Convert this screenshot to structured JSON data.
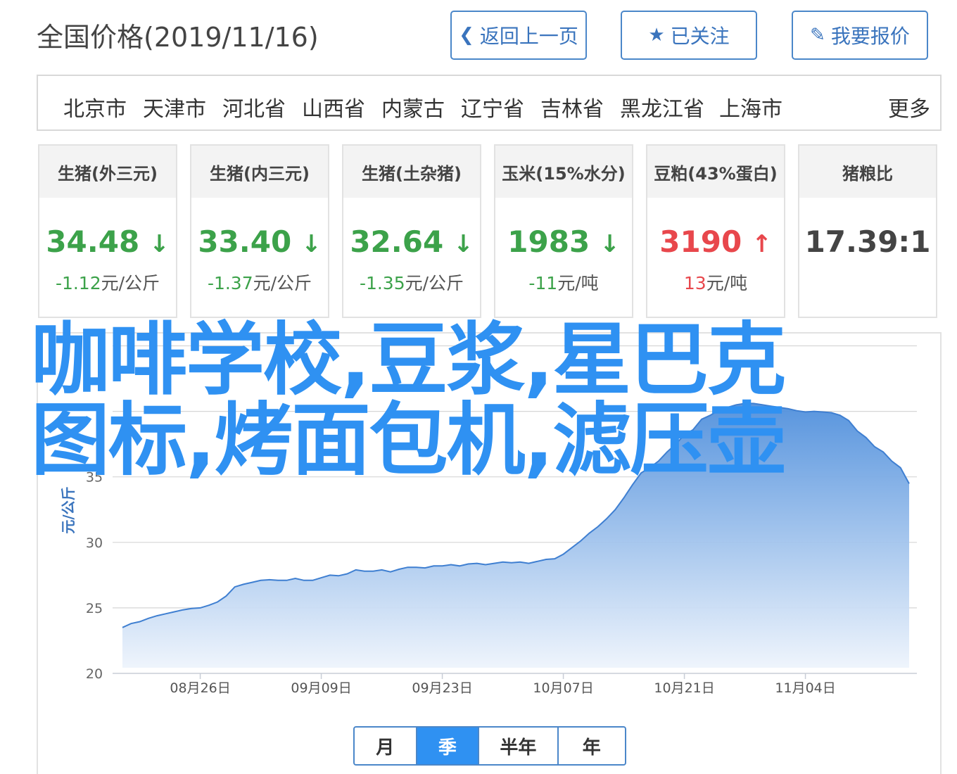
{
  "page_title": "全国价格(2019/11/16)",
  "buttons": {
    "back": "返回上一页",
    "followed": "已关注",
    "quote": "我要报价"
  },
  "nav": {
    "items": [
      "北京市",
      "天津市",
      "河北省",
      "山西省",
      "内蒙古",
      "辽宁省",
      "吉林省",
      "黑龙江省",
      "上海市"
    ],
    "more": "更多"
  },
  "cards": [
    {
      "title": "生猪(外三元)",
      "price": "34.48",
      "arrow": "↓",
      "trend": "down",
      "change_value": "-1.12",
      "change_unit": "元/公斤"
    },
    {
      "title": "生猪(内三元)",
      "price": "33.40",
      "arrow": "↓",
      "trend": "down",
      "change_value": "-1.37",
      "change_unit": "元/公斤"
    },
    {
      "title": "生猪(土杂猪)",
      "price": "32.64",
      "arrow": "↓",
      "trend": "down",
      "change_value": "-1.35",
      "change_unit": "元/公斤"
    },
    {
      "title": "玉米(15%水分)",
      "price": "1983",
      "arrow": "↓",
      "trend": "down",
      "change_value": "-11",
      "change_unit": "元/吨"
    },
    {
      "title": "豆粕(43%蛋白)",
      "price": "3190",
      "arrow": "↑",
      "trend": "up",
      "change_value": "13",
      "change_unit": "元/吨"
    },
    {
      "title": "猪粮比",
      "price": "17.39:1",
      "arrow": "",
      "trend": "none",
      "change_value": "",
      "change_unit": ""
    }
  ],
  "overlay": {
    "line1": "咖啡学校,豆浆,星巴克",
    "line2": "图标,烤面包机,滤压壶"
  },
  "chart_data": {
    "type": "area",
    "ylabel": "元/公斤",
    "ylim": [
      20,
      45
    ],
    "yticks": [
      20,
      25,
      30,
      35
    ],
    "xtick_labels": [
      "08月26日",
      "09月09日",
      "09月23日",
      "10月07日",
      "10月21日",
      "11月04日"
    ],
    "x": [
      "08月17日",
      "08月18日",
      "08月19日",
      "08月20日",
      "08月21日",
      "08月22日",
      "08月23日",
      "08月24日",
      "08月25日",
      "08月26日",
      "08月27日",
      "08月28日",
      "08月29日",
      "08月30日",
      "08月31日",
      "09月01日",
      "09月02日",
      "09月03日",
      "09月04日",
      "09月05日",
      "09月06日",
      "09月07日",
      "09月08日",
      "09月09日",
      "09月10日",
      "09月11日",
      "09月12日",
      "09月13日",
      "09月14日",
      "09月15日",
      "09月16日",
      "09月17日",
      "09月18日",
      "09月19日",
      "09月20日",
      "09月21日",
      "09月22日",
      "09月23日",
      "09月24日",
      "09月25日",
      "09月26日",
      "09月27日",
      "09月28日",
      "09月29日",
      "09月30日",
      "10月01日",
      "10月02日",
      "10月03日",
      "10月04日",
      "10月05日",
      "10月06日",
      "10月07日",
      "10月08日",
      "10月09日",
      "10月10日",
      "10月11日",
      "10月12日",
      "10月13日",
      "10月14日",
      "10月15日",
      "10月16日",
      "10月17日",
      "10月18日",
      "10月19日",
      "10月20日",
      "10月21日",
      "10月22日",
      "10月23日",
      "10月24日",
      "10月25日",
      "10月26日",
      "10月27日",
      "10月28日",
      "10月29日",
      "10月30日",
      "10月31日",
      "11月01日",
      "11月02日",
      "11月03日",
      "11月04日",
      "11月05日",
      "11月06日",
      "11月07日",
      "11月08日",
      "11月09日",
      "11月10日",
      "11月11日",
      "11月12日",
      "11月13日",
      "11月14日",
      "11月15日",
      "11月16日"
    ],
    "values": [
      23.5,
      23.8,
      23.95,
      24.2,
      24.4,
      24.55,
      24.7,
      24.85,
      24.95,
      25.0,
      25.2,
      25.45,
      25.9,
      26.6,
      26.8,
      26.95,
      27.1,
      27.15,
      27.1,
      27.1,
      27.25,
      27.1,
      27.1,
      27.3,
      27.5,
      27.45,
      27.6,
      27.9,
      27.8,
      27.8,
      27.9,
      27.75,
      27.95,
      28.1,
      28.1,
      28.05,
      28.2,
      28.2,
      28.3,
      28.2,
      28.35,
      28.4,
      28.3,
      28.4,
      28.5,
      28.45,
      28.5,
      28.4,
      28.55,
      28.7,
      28.75,
      29.1,
      29.6,
      30.1,
      30.7,
      31.2,
      31.8,
      32.5,
      33.4,
      34.4,
      35.3,
      35.7,
      36.2,
      36.9,
      37.5,
      38.2,
      38.6,
      39.4,
      39.7,
      40.1,
      40.3,
      40.5,
      40.6,
      40.6,
      40.5,
      40.4,
      40.3,
      40.2,
      40.05,
      39.95,
      40.0,
      39.95,
      39.9,
      39.7,
      39.3,
      38.5,
      38.0,
      37.3,
      36.9,
      36.2,
      35.7,
      34.48
    ]
  },
  "range_tabs": [
    "月",
    "季",
    "半年",
    "年"
  ],
  "range_active": "季",
  "colors": {
    "accent": "#2f91f2",
    "border": "#4b87c9",
    "down": "#3ca24a",
    "up": "#e8474c",
    "area_top": "#4f8fdc",
    "area_bottom": "#eef4fc"
  }
}
